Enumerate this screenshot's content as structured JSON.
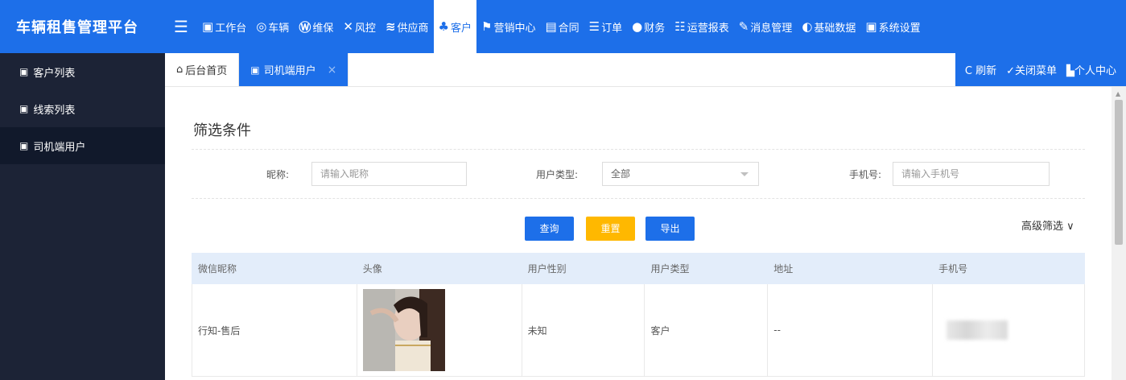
{
  "app": {
    "title": "车辆租售管理平台",
    "menu_toggle_icon": "menu-fold-icon"
  },
  "topnav": [
    {
      "icon": "▣",
      "icon_name": "dashboard-icon",
      "label": "工作台"
    },
    {
      "icon": "◎",
      "icon_name": "layers-icon",
      "label": "车辆"
    },
    {
      "icon": "Ⓦ",
      "icon_name": "document-w-icon",
      "label": "维保"
    },
    {
      "icon": "✕",
      "icon_name": "tools-icon",
      "label": "风控"
    },
    {
      "icon": "≋",
      "icon_name": "stack-icon",
      "label": "供应商"
    },
    {
      "icon": "♣",
      "icon_name": "user-icon",
      "label": "客户",
      "active": true
    },
    {
      "icon": "⚑",
      "icon_name": "flag-icon",
      "label": "营销中心"
    },
    {
      "icon": "▤",
      "icon_name": "file-icon",
      "label": "合同"
    },
    {
      "icon": "☰",
      "icon_name": "list-icon",
      "label": "订单"
    },
    {
      "icon": "●",
      "icon_name": "money-icon",
      "label": "财务"
    },
    {
      "icon": "☷",
      "icon_name": "list-bullet-icon",
      "label": "运营报表"
    },
    {
      "icon": "✎",
      "icon_name": "edit-icon",
      "label": "消息管理"
    },
    {
      "icon": "◐",
      "icon_name": "refresh-circle-icon",
      "label": "基础数据"
    },
    {
      "icon": "▣",
      "icon_name": "settings-window-icon",
      "label": "系统设置"
    }
  ],
  "sidebar": {
    "items": [
      {
        "icon": "▣",
        "label": "客户列表"
      },
      {
        "icon": "▣",
        "label": "线索列表"
      },
      {
        "icon": "▣",
        "label": "司机端用户",
        "active": true
      }
    ]
  },
  "tabs": {
    "home": {
      "icon": "⌂",
      "label": "后台首页"
    },
    "current": {
      "icon": "▣",
      "label": "司机端用户",
      "close": "×"
    },
    "actions": {
      "refresh": "C 刷新",
      "close_menu": "✓关闭菜单",
      "profile": "▙个人中心"
    }
  },
  "filter": {
    "title": "筛选条件",
    "nickname_label": "昵称:",
    "nickname_placeholder": "请输入昵称",
    "usertype_label": "用户类型:",
    "usertype_value": "全部",
    "phone_label": "手机号:",
    "phone_placeholder": "请输入手机号",
    "query_button": "查询",
    "reset_button": "重置",
    "export_button": "导出",
    "advanced": "高级筛选 ∨"
  },
  "table": {
    "headers": [
      "微信昵称",
      "头像",
      "用户性别",
      "用户类型",
      "地址",
      "手机号"
    ],
    "rows": [
      {
        "nickname": "行知-售后",
        "gender": "未知",
        "type": "客户",
        "address": "--"
      }
    ]
  }
}
